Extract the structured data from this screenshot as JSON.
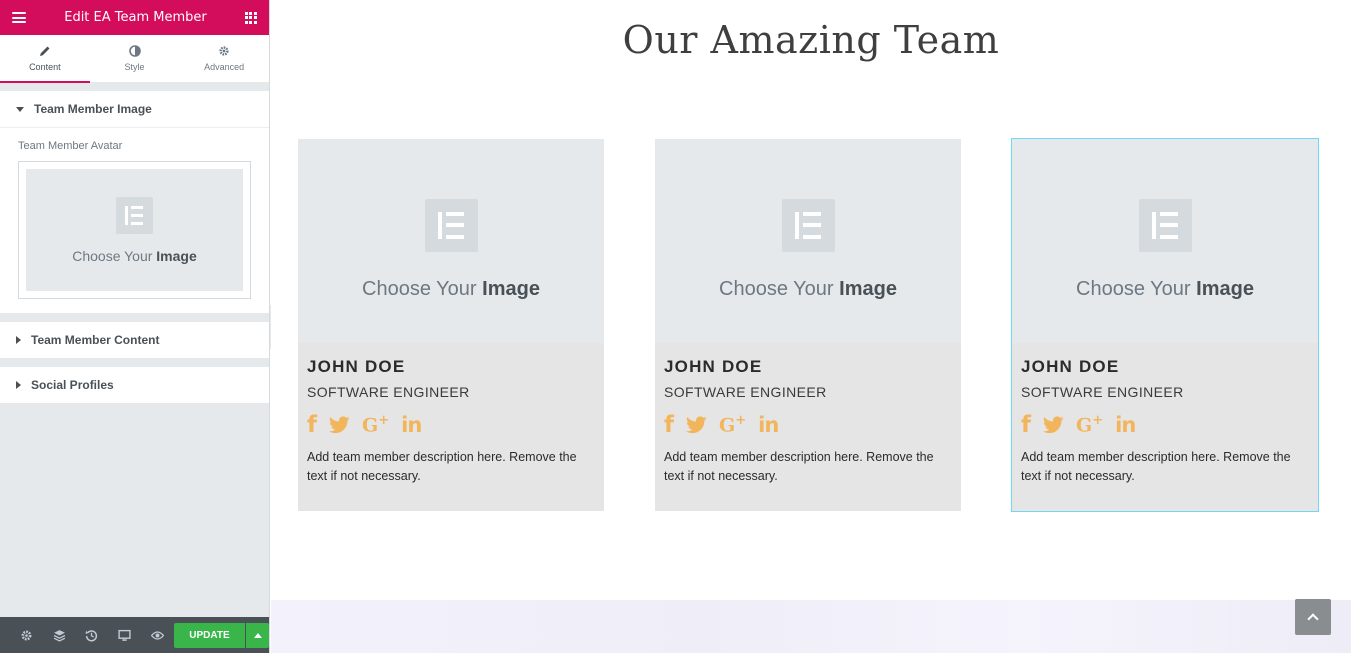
{
  "sidebar": {
    "header_title": "Edit EA Team Member",
    "tabs": [
      {
        "label": "Content",
        "icon": "pencil-icon",
        "active": true
      },
      {
        "label": "Style",
        "icon": "contrast-icon",
        "active": false
      },
      {
        "label": "Advanced",
        "icon": "gear-icon",
        "active": false
      }
    ],
    "sections": {
      "image": {
        "title": "Team Member Image",
        "expanded": true
      },
      "content": {
        "title": "Team Member Content",
        "expanded": false
      },
      "social": {
        "title": "Social Profiles",
        "expanded": false
      }
    },
    "avatar_label": "Team Member Avatar",
    "media_placeholder": {
      "prefix": "Choose Your ",
      "bold": "Image"
    },
    "footer": {
      "icons": [
        "settings-icon",
        "layers-icon",
        "history-icon",
        "responsive-icon",
        "preview-icon"
      ],
      "update_label": "UPDATE"
    }
  },
  "canvas": {
    "heading": "Our Amazing Team",
    "placeholder": {
      "prefix": "Choose Your ",
      "bold": "Image"
    },
    "members": [
      {
        "name": "JOHN DOE",
        "role": "SOFTWARE ENGINEER",
        "description": "Add team member description here. Remove the text if not necessary.",
        "selected": false
      },
      {
        "name": "JOHN DOE",
        "role": "SOFTWARE ENGINEER",
        "description": "Add team member description here. Remove the text if not necessary.",
        "selected": false
      },
      {
        "name": "JOHN DOE",
        "role": "SOFTWARE ENGINEER",
        "description": "Add team member description here. Remove the text if not necessary.",
        "selected": true
      }
    ],
    "social_icons": [
      "facebook-icon",
      "twitter-icon",
      "google-plus-icon",
      "linkedin-icon"
    ],
    "colors": {
      "social": "#f2b55c",
      "accent": "#d30c5c",
      "update": "#39b54a",
      "selected_outline": "#71d7f7"
    }
  }
}
